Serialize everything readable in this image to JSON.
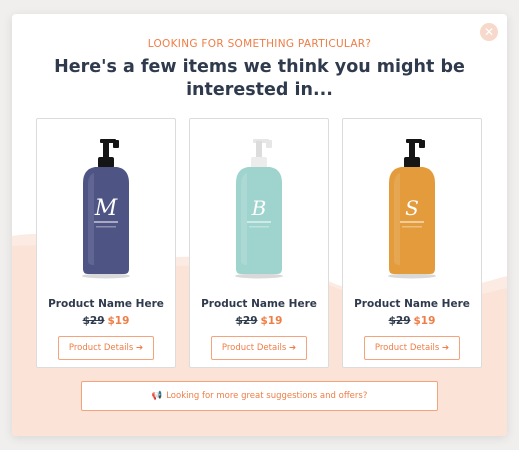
{
  "modal": {
    "close_icon": "close-icon",
    "close_glyph": "✕",
    "eyebrow": "LOOKING FOR SOMETHING PARTICULAR?",
    "headline": "Here's a few items we think you might be interested in...",
    "colors": {
      "accent": "#ef7d45",
      "heading": "#2f3a4d",
      "wave": "#fcebe2"
    }
  },
  "products": [
    {
      "name": "Product Name Here",
      "old_price": "$29",
      "new_price": "$19",
      "details_label": "Product Details",
      "details_arrow": "➔",
      "letter": "M",
      "bottle_color": "#4e5585"
    },
    {
      "name": "Product Name Here",
      "old_price": "$29",
      "new_price": "$19",
      "details_label": "Product Details",
      "details_arrow": "➔",
      "letter": "B",
      "bottle_color": "#9fd3ce"
    },
    {
      "name": "Product Name Here",
      "old_price": "$29",
      "new_price": "$19",
      "details_label": "Product Details",
      "details_arrow": "➔",
      "letter": "S",
      "bottle_color": "#e39b3b"
    }
  ],
  "footer": {
    "more_label": "Looking for more great suggestions and offers?",
    "megaphone_icon": "megaphone-icon",
    "megaphone_glyph": "📢"
  }
}
